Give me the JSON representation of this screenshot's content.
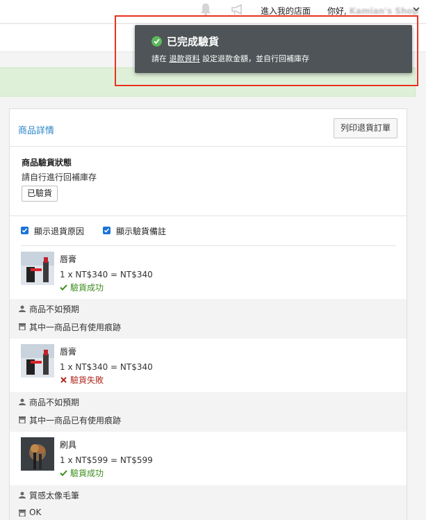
{
  "topbar": {
    "bell_icon": "bell-icon",
    "megaphone_icon": "megaphone-icon",
    "store_link": "進入我的店面",
    "greeting": "你好,",
    "shop_name": "Kamian's Shop"
  },
  "toast": {
    "title": "已完成驗貨",
    "msg_prefix": "請在 ",
    "msg_link": "退款資料",
    "msg_suffix": " 設定退款金額，並自行回補庫存",
    "check_color": "#5cb85c",
    "bg_color": "#4e5457"
  },
  "panel": {
    "title": "商品詳情",
    "print_button": "列印退貨訂單"
  },
  "status": {
    "heading": "商品驗貨狀態",
    "hint": "請自行進行回補庫存",
    "badge": "已驗貨"
  },
  "options": {
    "show_reason": "顯示退貨原因",
    "show_note": "顯示驗貨備註"
  },
  "items": [
    {
      "name": "唇膏",
      "price": "1 x NT$340 = NT$340",
      "result": "驗貨成功",
      "result_type": "success",
      "reason": "商品不如預期",
      "note": "其中一商品已有使用痕跡"
    },
    {
      "name": "唇膏",
      "price": "1 x NT$340 = NT$340",
      "result": "驗貨失敗",
      "result_type": "fail",
      "reason": "商品不如預期",
      "note": "其中一商品已有使用痕跡"
    },
    {
      "name": "刷具",
      "price": "1 x NT$599 = NT$599",
      "result": "驗貨成功",
      "result_type": "success",
      "reason": "質感太像毛筆",
      "note": "OK"
    }
  ],
  "colors": {
    "accent": "#2a86c8",
    "success": "#3c8d1e",
    "fail": "#b12a1f",
    "highlight_frame": "#e8321f"
  }
}
